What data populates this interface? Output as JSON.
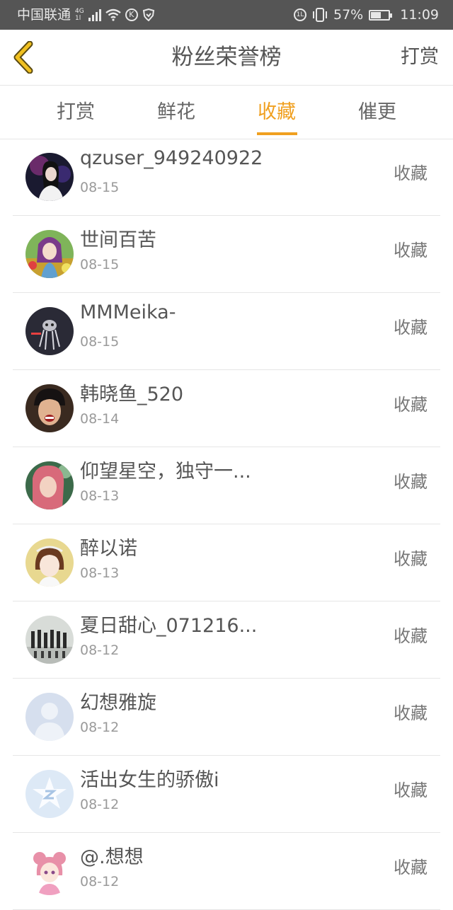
{
  "status_bar": {
    "carrier": "中国联通",
    "network": "4G",
    "network_sub": "1l",
    "battery": "57%",
    "battery_level": 0.57,
    "time": "11:09"
  },
  "header": {
    "title": "粉丝荣誉榜",
    "action": "打赏"
  },
  "tabs": [
    {
      "label": "打赏",
      "active": false
    },
    {
      "label": "鲜花",
      "active": false
    },
    {
      "label": "收藏",
      "active": true
    },
    {
      "label": "催更",
      "active": false
    }
  ],
  "accent_color": "#f0a020",
  "list": [
    {
      "name": "qzuser_949240922",
      "date": "08-15",
      "action": "收藏"
    },
    {
      "name": "世间百苦",
      "date": "08-15",
      "action": "收藏"
    },
    {
      "name": "MMMeika-",
      "date": "08-15",
      "action": "收藏"
    },
    {
      "name": "韩晓鱼_520",
      "date": "08-14",
      "action": "收藏"
    },
    {
      "name": "仰望星空，独守一...",
      "date": "08-13",
      "action": "收藏"
    },
    {
      "name": "醉以诺",
      "date": "08-13",
      "action": "收藏"
    },
    {
      "name": "夏日甜心_071216...",
      "date": "08-12",
      "action": "收藏"
    },
    {
      "name": "幻想雅旋",
      "date": "08-12",
      "action": "收藏"
    },
    {
      "name": "活出女生的骄傲i",
      "date": "08-12",
      "action": "收藏"
    },
    {
      "name": "@.想想",
      "date": "08-12",
      "action": "收藏"
    }
  ]
}
